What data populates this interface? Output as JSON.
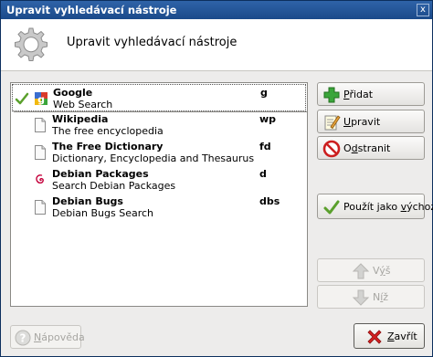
{
  "window": {
    "title": "Upravit vyhledávací nástroje",
    "close_glyph": "x"
  },
  "header": {
    "title": "Upravit vyhledávací nástroje",
    "icon": "gear-icon"
  },
  "engines": [
    {
      "name": "Google",
      "description": "Web Search",
      "keyword": "g",
      "default": true,
      "icon": "google-icon"
    },
    {
      "name": "Wikipedia",
      "description": "The free encyclopedia",
      "keyword": "wp",
      "default": false,
      "icon": "document-icon"
    },
    {
      "name": "The Free Dictionary",
      "description": "Dictionary, Encyclopedia and Thesaurus",
      "keyword": "fd",
      "default": false,
      "icon": "document-icon"
    },
    {
      "name": "Debian Packages",
      "description": "Search Debian Packages",
      "keyword": "d",
      "default": false,
      "icon": "debian-swirl-icon"
    },
    {
      "name": "Debian Bugs",
      "description": "Debian Bugs Search",
      "keyword": "dbs",
      "default": false,
      "icon": "document-icon"
    }
  ],
  "buttons": {
    "add": {
      "pre": "",
      "mn": "P",
      "post": "řidat"
    },
    "edit": {
      "pre": "",
      "mn": "U",
      "post": "pravit"
    },
    "remove": {
      "pre": "O",
      "mn": "d",
      "post": "stranit"
    },
    "default": {
      "pre": "Použít jako ",
      "mn": "v",
      "post": "ýchozí"
    },
    "up": {
      "pre": "V",
      "mn": "ý",
      "post": "š"
    },
    "down": {
      "pre": "N",
      "mn": "í",
      "post": "ž"
    },
    "help": {
      "pre": "",
      "mn": "N",
      "post": "ápověda"
    },
    "close": {
      "pre": "",
      "mn": "Z",
      "post": "avřít"
    }
  },
  "colors": {
    "titlebar": "#2f63a8",
    "add_green": "#3aa53a",
    "remove_red": "#cc1f1f",
    "check_green": "#5aa02c"
  }
}
